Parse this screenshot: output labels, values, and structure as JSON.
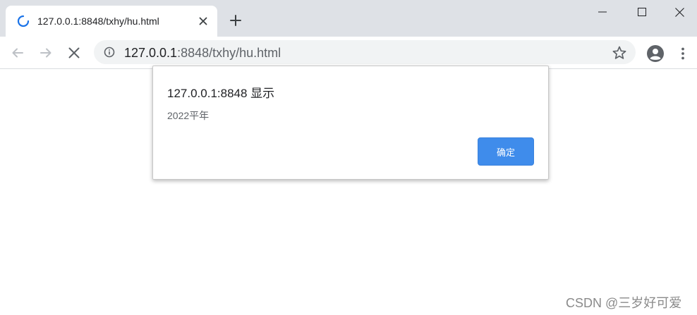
{
  "tab": {
    "title": "127.0.0.1:8848/txhy/hu.html",
    "spinner_icon": "loading-spinner-icon",
    "accent": "#1a73e8"
  },
  "window_controls": {
    "minimize_icon": "minimize-icon",
    "maximize_icon": "maximize-icon",
    "close_icon": "close-icon"
  },
  "toolbar": {
    "back_icon": "arrow-left-icon",
    "forward_icon": "arrow-right-icon",
    "stop_icon": "stop-x-icon",
    "url_host": "127.0.0.1",
    "url_rest": ":8848/txhy/hu.html"
  },
  "dialog": {
    "title": "127.0.0.1:8848 显示",
    "message": "2022平年",
    "ok_label": "确定",
    "ok_color": "#3f8ceb"
  },
  "watermark": "CSDN @三岁好可爱"
}
